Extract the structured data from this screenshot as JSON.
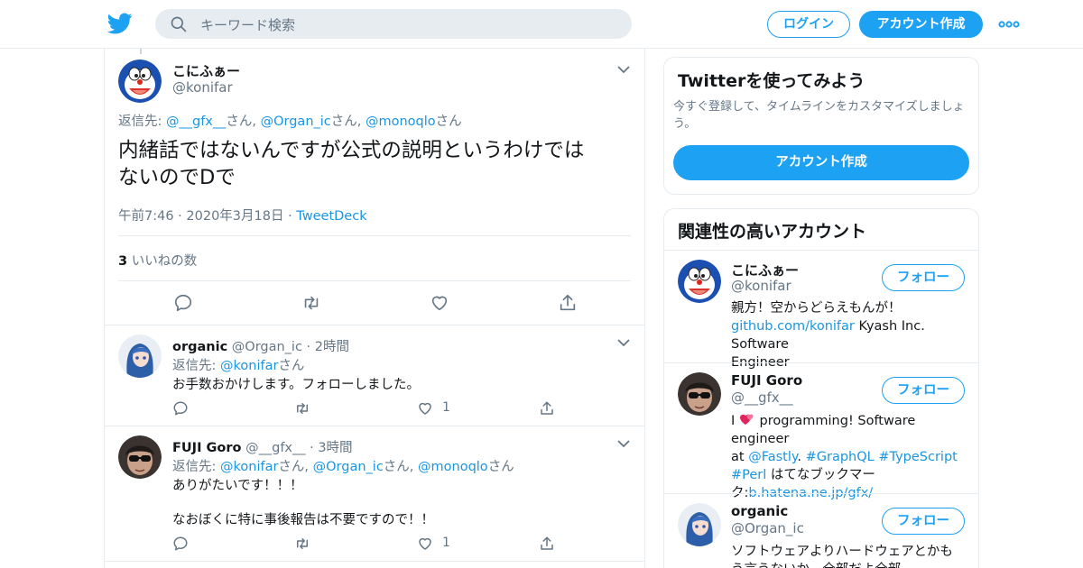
{
  "header": {
    "search_placeholder": "キーワード検索",
    "login": "ログイン",
    "signup": "アカウント作成",
    "colors": {
      "accent": "#1da1f2",
      "link": "#1b95e0"
    }
  },
  "tweet": {
    "name": "こにふぁー",
    "handle": "@konifar",
    "reply_prefix": "返信先: ",
    "reply_to": [
      "@__gfx__",
      "@Organ_ic",
      "@monoqlo"
    ],
    "san": "さん",
    "comma": ", ",
    "text_line1": "内緒話ではないんですが公式の説明というわけでは",
    "text_line2": "ないのでDで",
    "timestamp": "午前7:46 · 2020年3月18日 · ",
    "source": "TweetDeck",
    "like_count": "3",
    "like_label": " いいねの数"
  },
  "replies": [
    {
      "name": "organic",
      "handle": "@Organ_ic",
      "time": "2時間",
      "reply_to": [
        "@konifar"
      ],
      "text_line1": "お手数おかけします。フォローしました。",
      "like_count": "1"
    },
    {
      "name": "FUJI Goro",
      "handle": "@__gfx__",
      "time": "3時間",
      "reply_to": [
        "@konifar",
        "@Organ_ic",
        "@monoqlo"
      ],
      "text_line1": "ありがたいです！！！",
      "text_line2": "なおぼくに特に事後報告は不要ですので！！",
      "like_count": "1"
    }
  ],
  "sidebar": {
    "try": {
      "title": "Twitterを使ってみよう",
      "desc": "今すぐ登録して、タイムラインをカスタマイズしましょう。",
      "button": "アカウント作成"
    },
    "related": {
      "title": "関連性の高いアカウント",
      "follow_label": "フォロー",
      "accounts": [
        {
          "name": "こにふぁー",
          "handle": "@konifar",
          "bio_line1": "親方！空からどらえもんが！",
          "bio_link": "github.com/konifar",
          "bio_rest": " Kyash Inc. Software",
          "bio_line3": "Engineer"
        },
        {
          "name": "FUJI Goro",
          "handle": "@__gfx__",
          "bio_i": "I ",
          "bio_emoji": "heart-emoji",
          "bio_prog": " programming! Software engineer",
          "bio_at": "at ",
          "bio_fastly": "@Fastly",
          "bio_dot": ". ",
          "bio_graphql": "#GraphQL",
          "bio_typescript": "#TypeScript",
          "bio_perl": "#Perl",
          "bio_hatena": " はてなブックマー",
          "bio_ku": "ク:",
          "bio_url": "b.hatena.ne.jp/gfx/"
        },
        {
          "name": "organic",
          "handle": "@Organ_ic",
          "bio_line1": "ソフトウェアよりハードウェアとかも",
          "bio_line2": "う言うないか。全部だよ全部"
        }
      ]
    }
  }
}
